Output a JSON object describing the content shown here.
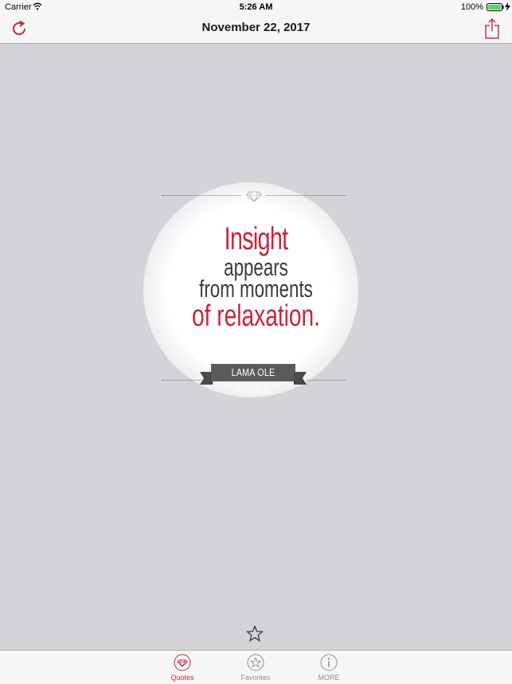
{
  "status_bar": {
    "carrier": "Carrier",
    "time": "5:26 AM",
    "battery": "100%"
  },
  "nav": {
    "title": "November 22, 2017",
    "left_icon": "refresh-icon",
    "right_icon": "share-icon"
  },
  "quote": {
    "line1": "Insight",
    "line2": "appears",
    "line3": "from moments",
    "line4": "of relaxation.",
    "author": "LAMA OLE NYDAHL"
  },
  "favorite_icon": "star-outline-icon",
  "tabs": [
    {
      "label": "Quotes",
      "icon": "gem-icon",
      "active": true
    },
    {
      "label": "Favorites",
      "icon": "star-badge-icon",
      "active": false
    },
    {
      "label": "MORE",
      "icon": "info-icon",
      "active": false
    }
  ],
  "colors": {
    "accent": "#c8243e",
    "background": "#d4d4d8",
    "bar": "#f6f6f6",
    "text_dark": "#3a3a3a",
    "ribbon": "#5b5b5b"
  }
}
